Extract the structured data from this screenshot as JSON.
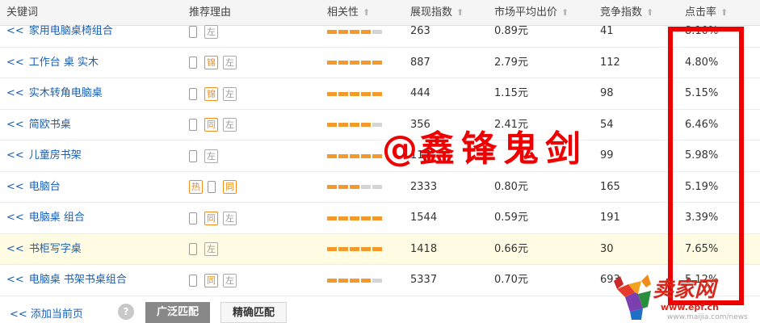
{
  "columns": {
    "keyword": "关键词",
    "reason": "推荐理由",
    "relevance": "相关性",
    "impressions": "展现指数",
    "avg_bid": "市场平均出价",
    "competition": "竞争指数",
    "ctr": "点击率"
  },
  "rows": [
    {
      "keyword": "家用电脑桌椅组合",
      "tags": [
        {
          "type": "phone"
        },
        {
          "type": "tag",
          "text": "左",
          "color": "gray"
        }
      ],
      "relevance": 4,
      "impressions": "263",
      "avg_bid": "0.89元",
      "competition": "41",
      "ctr": "8.10%"
    },
    {
      "keyword": "工作台 桌 实木",
      "tags": [
        {
          "type": "phone"
        },
        {
          "type": "tag",
          "text": "锦",
          "color": "orange"
        },
        {
          "type": "tag",
          "text": "左",
          "color": "gray"
        }
      ],
      "relevance": 5,
      "impressions": "887",
      "avg_bid": "2.79元",
      "competition": "112",
      "ctr": "4.80%"
    },
    {
      "keyword": "实木转角电脑桌",
      "tags": [
        {
          "type": "phone"
        },
        {
          "type": "tag",
          "text": "锦",
          "color": "orange"
        },
        {
          "type": "tag",
          "text": "左",
          "color": "gray"
        }
      ],
      "relevance": 5,
      "impressions": "444",
      "avg_bid": "1.15元",
      "competition": "98",
      "ctr": "5.15%"
    },
    {
      "keyword": "简欧书桌",
      "tags": [
        {
          "type": "phone"
        },
        {
          "type": "tag",
          "text": "同",
          "color": "orange"
        },
        {
          "type": "tag",
          "text": "左",
          "color": "gray"
        }
      ],
      "relevance": 4,
      "impressions": "356",
      "avg_bid": "2.41元",
      "competition": "54",
      "ctr": "6.46%"
    },
    {
      "keyword": "儿童房书架",
      "tags": [
        {
          "type": "phone"
        },
        {
          "type": "tag",
          "text": "左",
          "color": "gray"
        }
      ],
      "relevance": 5,
      "impressions": "117",
      "avg_bid": "",
      "competition": "99",
      "ctr": "5.98%"
    },
    {
      "keyword": "电脑台",
      "tags": [
        {
          "type": "tag",
          "text": "热",
          "color": "orange"
        },
        {
          "type": "phone"
        },
        {
          "type": "tag",
          "text": "同",
          "color": "orange"
        }
      ],
      "relevance": 3,
      "impressions": "2333",
      "avg_bid": "0.80元",
      "competition": "165",
      "ctr": "5.19%"
    },
    {
      "keyword": "电脑桌 组合",
      "tags": [
        {
          "type": "phone"
        },
        {
          "type": "tag",
          "text": "同",
          "color": "orange"
        },
        {
          "type": "tag",
          "text": "左",
          "color": "gray"
        }
      ],
      "relevance": 5,
      "impressions": "1544",
      "avg_bid": "0.59元",
      "competition": "191",
      "ctr": "3.39%"
    },
    {
      "keyword": "书柜写字桌",
      "tags": [
        {
          "type": "phone"
        },
        {
          "type": "tag",
          "text": "左",
          "color": "gray"
        }
      ],
      "relevance": 5,
      "impressions": "1418",
      "avg_bid": "0.66元",
      "competition": "30",
      "ctr": "7.65%",
      "highlight": true
    },
    {
      "keyword": "电脑桌 书架书桌组合",
      "tags": [
        {
          "type": "phone"
        },
        {
          "type": "tag",
          "text": "同",
          "color": "orange"
        },
        {
          "type": "tag",
          "text": "左",
          "color": "gray"
        }
      ],
      "relevance": 4,
      "impressions": "5337",
      "avg_bid": "0.70元",
      "competition": "693",
      "ctr": "5.12%"
    }
  ],
  "row_arrow": "<<",
  "relevance_max": 5,
  "footer": {
    "add_page": "<< 添加当前页",
    "help": "?",
    "broad_match": "广泛匹配",
    "exact_match": "精确匹配"
  },
  "watermark": {
    "at": "@",
    "name": "鑫锋鬼剑"
  },
  "logo": {
    "name": "卖家网",
    "url": "www.epf.cn",
    "url2": "www.maijia.com/news"
  },
  "colors": {
    "link": "#1a5fb4",
    "accent": "#f39a2b",
    "highlight_row": "#fffce3",
    "annotation": "#ee0000"
  }
}
